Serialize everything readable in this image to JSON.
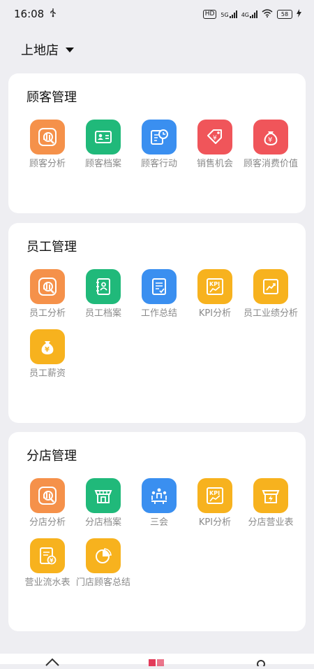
{
  "status_bar": {
    "time": "16:08",
    "usb_icon": "usb-icon",
    "hd_label": "HD",
    "net_5g": "5G",
    "net_4g": "4G",
    "battery": "58"
  },
  "store_selector": {
    "label": "上地店"
  },
  "sections": [
    {
      "title": "顾客管理",
      "items": [
        {
          "label": "顾客分析",
          "icon": "analysis-icon",
          "color": "#f5914a"
        },
        {
          "label": "顾客档案",
          "icon": "profile-card-icon",
          "color": "#20b97a"
        },
        {
          "label": "顾客行动",
          "icon": "action-clock-icon",
          "color": "#3a8ff0"
        },
        {
          "label": "销售机会",
          "icon": "price-tag-icon",
          "color": "#f0555a"
        },
        {
          "label": "顾客消费价值",
          "icon": "money-bag-icon",
          "color": "#f0555a"
        }
      ]
    },
    {
      "title": "员工管理",
      "items": [
        {
          "label": "员工分析",
          "icon": "analysis-icon",
          "color": "#f5914a"
        },
        {
          "label": "员工档案",
          "icon": "profile-book-icon",
          "color": "#20b97a"
        },
        {
          "label": "工作总结",
          "icon": "document-check-icon",
          "color": "#3a8ff0"
        },
        {
          "label": "KPI分析",
          "icon": "kpi-icon",
          "color": "#f7b21e"
        },
        {
          "label": "员工业绩分析",
          "icon": "trend-chart-icon",
          "color": "#f7b21e"
        },
        {
          "label": "员工薪资",
          "icon": "money-bag-icon",
          "color": "#f7b21e"
        }
      ]
    },
    {
      "title": "分店管理",
      "items": [
        {
          "label": "分店分析",
          "icon": "analysis-icon",
          "color": "#f5914a"
        },
        {
          "label": "分店档案",
          "icon": "storefront-icon",
          "color": "#20b97a"
        },
        {
          "label": "三会",
          "icon": "meeting-icon",
          "color": "#3a8ff0"
        },
        {
          "label": "KPI分析",
          "icon": "kpi-icon",
          "color": "#f7b21e"
        },
        {
          "label": "分店营业表",
          "icon": "shop-bolt-icon",
          "color": "#f7b21e"
        },
        {
          "label": "营业流水表",
          "icon": "receipt-yen-icon",
          "color": "#f7b21e"
        },
        {
          "label": "门店顾客总结",
          "icon": "pie-chart-icon",
          "color": "#f7b21e"
        }
      ]
    }
  ]
}
